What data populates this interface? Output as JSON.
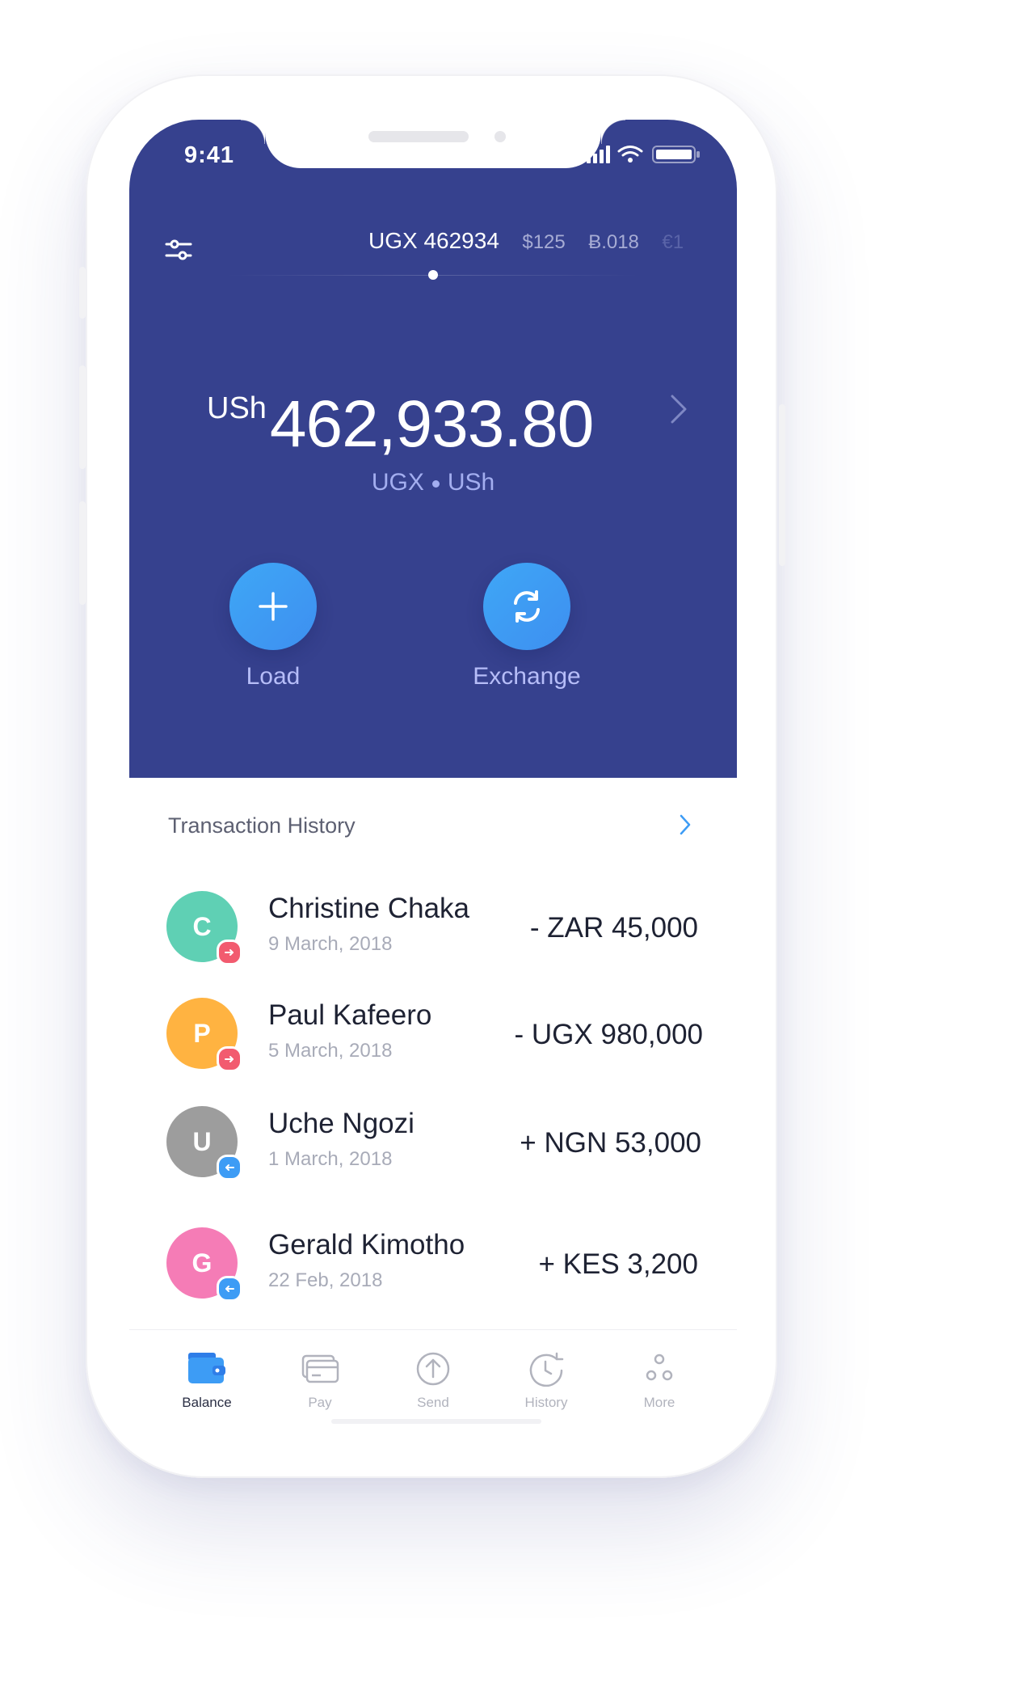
{
  "status_bar": {
    "time": "9:41"
  },
  "currency_strip": {
    "active": "UGX 462934",
    "others": [
      "$125",
      "Ƀ.018"
    ],
    "faded": "€1"
  },
  "balance": {
    "symbol": "USh",
    "amount": "462,933.80",
    "code": "UGX",
    "unit": "USh"
  },
  "actions": {
    "load_label": "Load",
    "exchange_label": "Exchange"
  },
  "transactions": {
    "title": "Transaction History",
    "items": [
      {
        "initial": "C",
        "name": "Christine Chaka",
        "date": "9 March, 2018",
        "amount": "- ZAR 45,000",
        "direction": "out",
        "color": "#5fd0b4"
      },
      {
        "initial": "P",
        "name": "Paul Kafeero",
        "date": "5 March, 2018",
        "amount": "- UGX 980,000",
        "direction": "out",
        "color": "#ffb341"
      },
      {
        "initial": "U",
        "name": "Uche Ngozi",
        "date": "1 March, 2018",
        "amount": "+ NGN 53,000",
        "direction": "in",
        "color": "#9d9d9d"
      },
      {
        "initial": "G",
        "name": "Gerald Kimotho",
        "date": "22 Feb, 2018",
        "amount": "+ KES 3,200",
        "direction": "in",
        "color": "#f57cb6"
      }
    ]
  },
  "tabbar": {
    "items": [
      {
        "label": "Balance",
        "icon": "wallet-icon",
        "active": true
      },
      {
        "label": "Pay",
        "icon": "card-icon",
        "active": false
      },
      {
        "label": "Send",
        "icon": "send-icon",
        "active": false
      },
      {
        "label": "History",
        "icon": "history-icon",
        "active": false
      },
      {
        "label": "More",
        "icon": "more-icon",
        "active": false
      }
    ]
  },
  "colors": {
    "hero_bg": "#36418e",
    "accent_blue": "#3d9cf5",
    "out_badge": "#f25b6f",
    "in_badge": "#3d9cf5"
  }
}
